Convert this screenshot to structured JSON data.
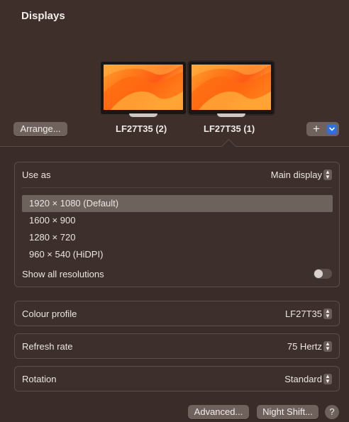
{
  "window": {
    "title": "Displays"
  },
  "displays": {
    "left_name": "LF27T35 (2)",
    "right_name": "LF27T35 (1)",
    "arrange_label": "Arrange...",
    "add_label": "+",
    "add_menu_icon": "chevron-down-icon"
  },
  "use_as": {
    "label": "Use as",
    "value": "Main display"
  },
  "resolutions": {
    "items": [
      "1920 × 1080 (Default)",
      "1600 × 900",
      "1280 × 720",
      "960 × 540 (HiDPI)"
    ],
    "selected_index": 0,
    "show_all_label": "Show all resolutions",
    "show_all_on": false
  },
  "colour_profile": {
    "label": "Colour profile",
    "value": "LF27T35"
  },
  "refresh_rate": {
    "label": "Refresh rate",
    "value": "75 Hertz"
  },
  "rotation": {
    "label": "Rotation",
    "value": "Standard"
  },
  "footer": {
    "advanced_label": "Advanced...",
    "night_shift_label": "Night Shift...",
    "help_label": "?"
  },
  "colors": {
    "accent": "#2f6fe0",
    "background": "#3a2c28",
    "selected_row": "#6e625d"
  }
}
